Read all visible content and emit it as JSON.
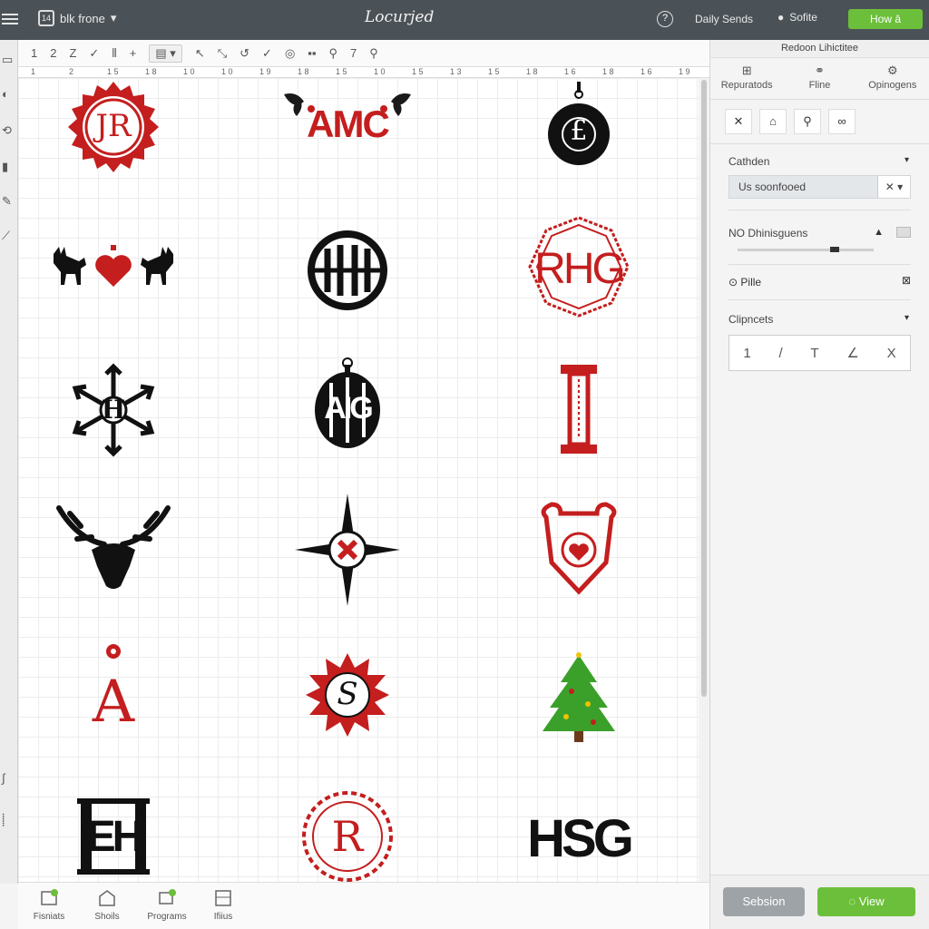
{
  "header": {
    "project_name": "blk frone",
    "brand": "Locurjed",
    "daily_label": "Daily Sends",
    "soft_label": "Sofite",
    "cta_label": "How â"
  },
  "toolbar": {
    "items": [
      "1",
      "2",
      "Z",
      "✓",
      "⫴",
      "+",
      "▤ ▾",
      "↖",
      "⤡",
      "↺",
      "✓",
      "◎",
      "▪▪",
      "⚲",
      "7",
      "⚲"
    ]
  },
  "ruler": {
    "ticks": [
      "1",
      "2",
      "1 5",
      "1 8",
      "1 0",
      "1 0",
      "1 9",
      "1 8",
      "1 5",
      "1 0",
      "1 5",
      "1 3",
      "1 5",
      "1 8",
      "1 6",
      "1 8",
      "1 6",
      "1 9"
    ]
  },
  "canvas": {
    "monograms": [
      {
        "label": "JR",
        "color": "#c41e1e"
      },
      {
        "label": "AMC",
        "color": "#c41e1e"
      },
      {
        "label": "£",
        "color": "#111111"
      },
      {
        "label": "",
        "color": "#c41e1e"
      },
      {
        "label": "",
        "color": "#111111"
      },
      {
        "label": "RHG",
        "color": "#c41e1e"
      },
      {
        "label": "H",
        "color": "#111111"
      },
      {
        "label": "AIG",
        "color": "#111111"
      },
      {
        "label": "I",
        "color": "#c41e1e"
      },
      {
        "label": "",
        "color": "#111111"
      },
      {
        "label": "",
        "color": "#111111"
      },
      {
        "label": "",
        "color": "#c41e1e"
      },
      {
        "label": "A",
        "color": "#c41e1e"
      },
      {
        "label": "S",
        "color": "#c41e1e"
      },
      {
        "label": "",
        "color": "#3aa02a"
      },
      {
        "label": "EH",
        "color": "#111111"
      },
      {
        "label": "R",
        "color": "#c41e1e"
      },
      {
        "label": "HSG",
        "color": "#111111"
      }
    ]
  },
  "bottom_nav": {
    "items": [
      "Fisniats",
      "Shoils",
      "Programs",
      "Ifiius"
    ]
  },
  "panel": {
    "header": "Redoon Lihictitee",
    "tabs": [
      "Repuratods",
      "Fline",
      "Opinogens"
    ],
    "section1_title": "Cathden",
    "select_value": "Us soonfooed",
    "select_x": "✕",
    "section2_title": "NO Dhinisguens",
    "sub_label": "Pille",
    "section3_title": "Clipncets",
    "chips": [
      "1",
      "/",
      "T",
      "∠",
      "X"
    ],
    "btn_secondary": "Sebsion",
    "btn_primary": "View"
  },
  "colors": {
    "accent_green": "#6cbf3a",
    "topbar": "#4b5257",
    "red": "#c41e1e"
  }
}
